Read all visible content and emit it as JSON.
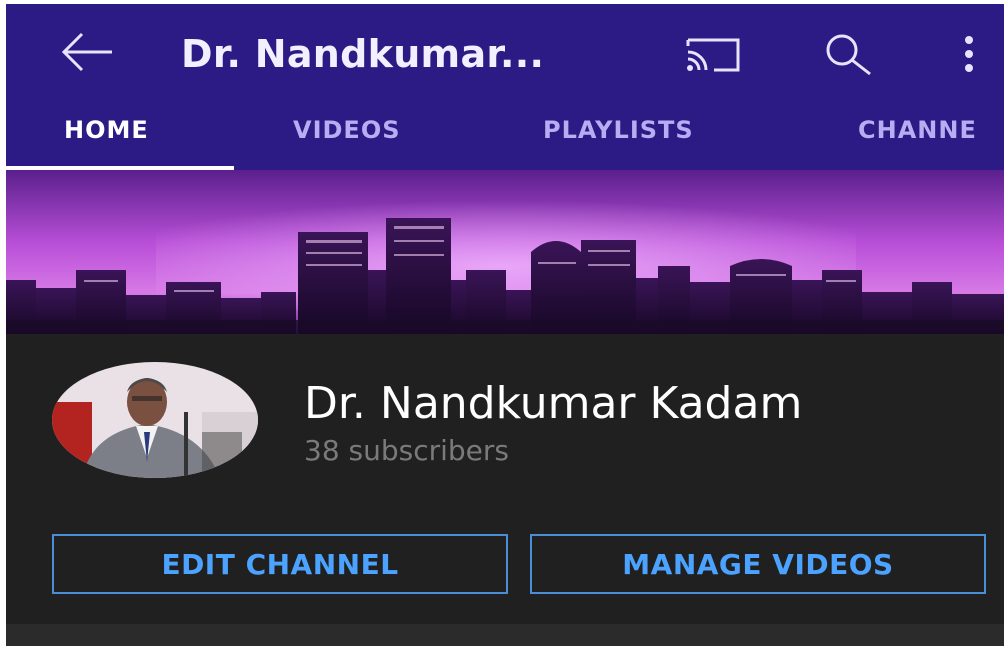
{
  "app_bar": {
    "title": "Dr. Nandkumar...",
    "back_icon": "arrow-left-icon",
    "cast_icon": "cast-icon",
    "search_icon": "search-icon",
    "more_icon": "more-vert-icon",
    "background_color": "#2c1a85"
  },
  "tabs": [
    {
      "label": "HOME",
      "active": true
    },
    {
      "label": "VIDEOS",
      "active": false
    },
    {
      "label": "PLAYLISTS",
      "active": false
    },
    {
      "label": "CHANNE",
      "active": false
    }
  ],
  "channel": {
    "name": "Dr. Nandkumar Kadam",
    "subscribers": "38 subscribers"
  },
  "buttons": {
    "edit_channel": "EDIT CHANNEL",
    "manage_videos": "MANAGE VIDEOS",
    "accent_color": "#4ba3ff"
  }
}
